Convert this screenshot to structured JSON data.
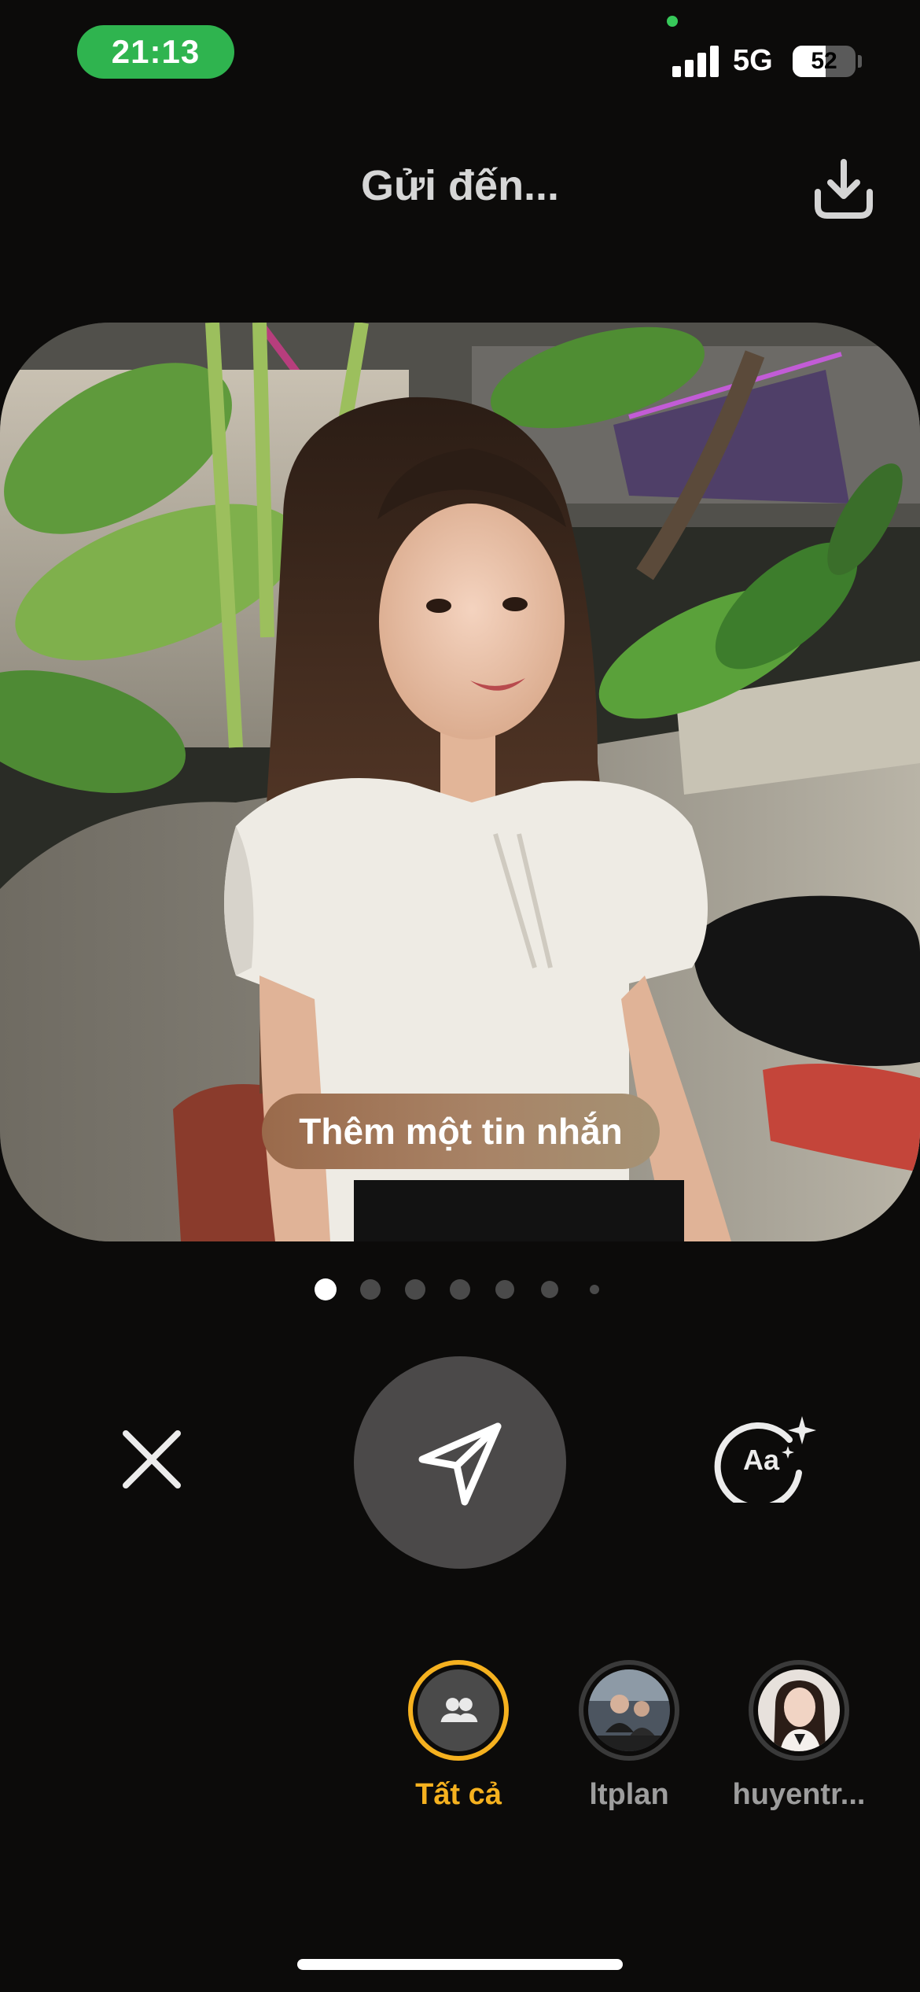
{
  "status_bar": {
    "time": "21:13",
    "network": "5G",
    "battery_level": "52",
    "battery_fraction": 0.52,
    "signal_bars": 4
  },
  "header": {
    "title": "Gửi đến...",
    "download_icon": "download-icon"
  },
  "photo": {
    "message_placeholder": "Thêm một tin nhắn"
  },
  "pager": {
    "count": 7,
    "active_index": 0
  },
  "actions": {
    "close_icon": "close-icon",
    "send_icon": "send-icon",
    "text_effect_icon": "text-style-sparkle-icon",
    "text_effect_glyph": "Aa"
  },
  "recipients": [
    {
      "label": "Tất cả",
      "icon": "group-icon",
      "selected": true
    },
    {
      "label": "ltplan",
      "icon": "avatar-photo",
      "selected": false
    },
    {
      "label": "huyentr...",
      "icon": "avatar-photo",
      "selected": false
    }
  ],
  "colors": {
    "accent": "#f5b11f",
    "time_pill": "#2fb44f",
    "background": "#0c0b0a",
    "send_button": "#4b4949"
  }
}
